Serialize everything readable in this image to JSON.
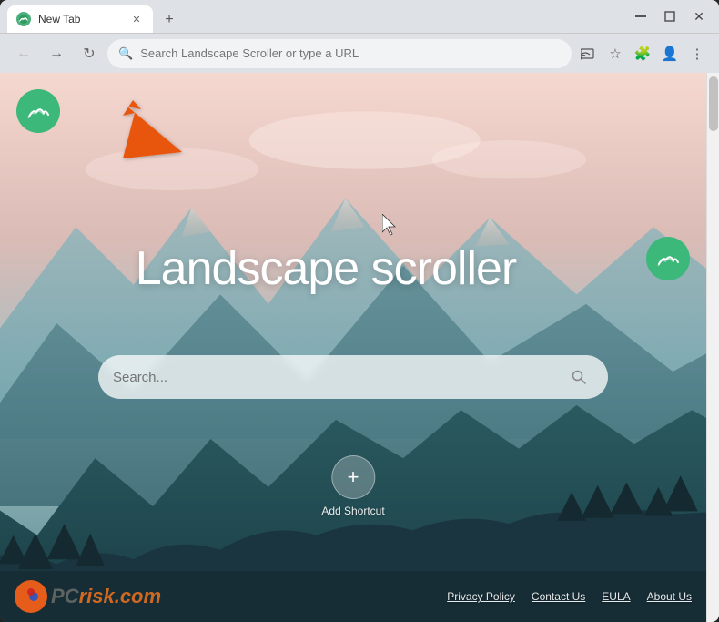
{
  "window": {
    "title": "New Tab",
    "favicon": "🌿"
  },
  "titlebar": {
    "tab_title": "New Tab",
    "new_tab_label": "+",
    "minimize": "—",
    "maximize": "□",
    "close": "✕"
  },
  "toolbar": {
    "back_label": "←",
    "forward_label": "→",
    "reload_label": "↻",
    "address_placeholder": "Search Landscape Scroller or type a URL",
    "address_value": "Search Landscape Scroller or type a URL"
  },
  "page": {
    "main_title": "Landscape scroller",
    "search_placeholder": "Search...",
    "add_shortcut_label": "Add Shortcut",
    "add_shortcut_icon": "+"
  },
  "footer": {
    "logo_text1": "PC",
    "logo_text2": "risk.com",
    "links": [
      {
        "label": "Privacy Policy"
      },
      {
        "label": "Contact Us"
      },
      {
        "label": "EULA"
      },
      {
        "label": "About Us"
      }
    ]
  }
}
